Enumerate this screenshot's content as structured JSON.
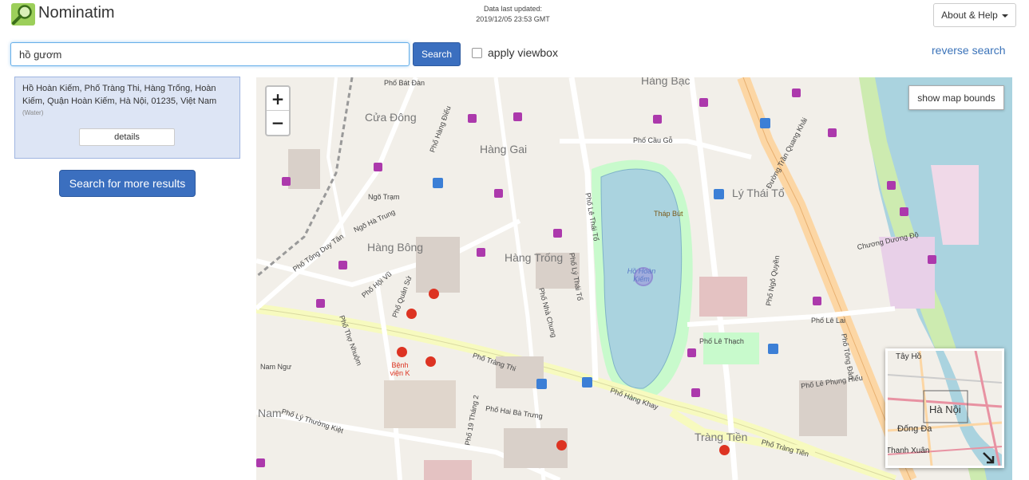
{
  "header": {
    "brand": "Nominatim",
    "last_updated_label": "Data last updated:",
    "last_updated_value": "2019/12/05 23:53 GMT",
    "about_label": "About & Help"
  },
  "search": {
    "query": "hồ gươm",
    "button_label": "Search",
    "viewbox_label": "apply viewbox",
    "viewbox_checked": false,
    "reverse_label": "reverse search"
  },
  "results": [
    {
      "name": "Hồ Hoàn Kiếm, Phố Tràng Thi, Hàng Trống, Hoàn Kiếm, Quận Hoàn Kiếm, Hà Nội, 01235, Việt Nam",
      "type": "(Water)",
      "details_label": "details"
    }
  ],
  "more_results_label": "Search for more results",
  "map": {
    "zoom_in": "+",
    "zoom_out": "−",
    "show_bounds_label": "show map bounds",
    "areas": [
      "Hàng Bạc",
      "Cửa Đông",
      "Hàng Gai",
      "Lý Thái Tổ",
      "Hàng Bông",
      "Hàng Trống",
      "Nam",
      "Tràng Tiền"
    ],
    "places": {
      "lake": "Hồ Hoàn Kiếm",
      "pagoda": "Tháp Bút",
      "hospital": "Bệnh viện K"
    },
    "streets": [
      "Phố Bát Đàn",
      "Phố Hàng Điếu",
      "Phố Cầu Gỗ",
      "Phố Tràng Thi",
      "Phố Hàng Khay",
      "Phố Tràng Tiền",
      "Phố Lê Thái Tổ",
      "Đường Trần Quang Khải",
      "Phố Lê Lai",
      "Phố Lê Thạch",
      "Phố Hai Bà Trưng",
      "Phố Quán Sứ",
      "Phố Nhà Chung",
      "Phố Lý Thường Kiệt",
      "Phố Ngô Quyền",
      "Phố Lê Phụng Hiểu",
      "Chương Dương Độ",
      "Phố Tông Đản",
      "Phố Thợ Nhuộm",
      "Phố Hội Vũ",
      "Phố Tông Duy Tân",
      "Ngõ Hà Trung",
      "Ngõ Trạm",
      "Phố 19 Tháng 2",
      "Nam Ngư",
      "Phố Lý Thái Tổ"
    ],
    "minimap_labels": [
      "Tây Hồ",
      "Hà Nội",
      "Đống Đa",
      "Thanh Xuân"
    ]
  },
  "colors": {
    "primary": "#3b6fbf",
    "water": "#aad3df",
    "park": "#c8facc",
    "poi_shop": "#ac39ac",
    "highway": "#fcd6a4",
    "result_bg": "#dde5f5"
  },
  "icons": [
    "search-logo-icon",
    "caret-down-icon"
  ]
}
